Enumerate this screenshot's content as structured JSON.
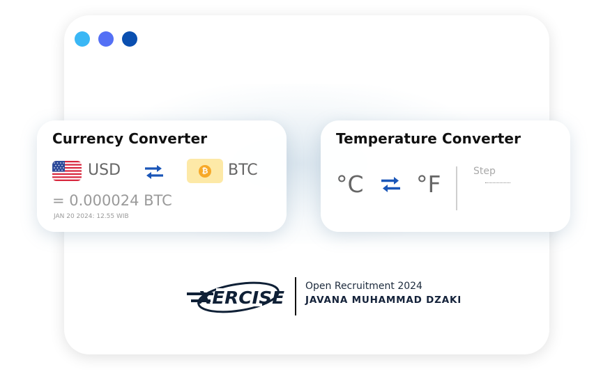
{
  "window_controls": [
    {
      "name": "dot-light-blue",
      "color": "#3ab7f5"
    },
    {
      "name": "dot-medium-blue",
      "color": "#5470f5"
    },
    {
      "name": "dot-dark-blue",
      "color": "#0a4fb0"
    }
  ],
  "currency": {
    "title": "Currency Converter",
    "from_code": "USD",
    "to_code": "BTC",
    "from_icon": "us-flag-icon",
    "to_icon": "bitcoin-icon",
    "coin_symbol": "₿",
    "result": "= 0.000024 BTC",
    "timestamp": "JAN 20 2024: 12.55 WIB"
  },
  "temperature": {
    "title": "Temperature Converter",
    "from_unit": "°C",
    "to_unit": "°F",
    "step_label": "Step",
    "step_value": ""
  },
  "branding": {
    "logo_text": "XERCISE",
    "subtitle": "Open Recruitment 2024",
    "author": "JAVANA MUHAMMAD DZAKI"
  },
  "colors": {
    "swap_icon": "#1a56b8",
    "coin_background": "#fde9a7",
    "coin": "#f7a928",
    "logo": "#0f2036"
  }
}
